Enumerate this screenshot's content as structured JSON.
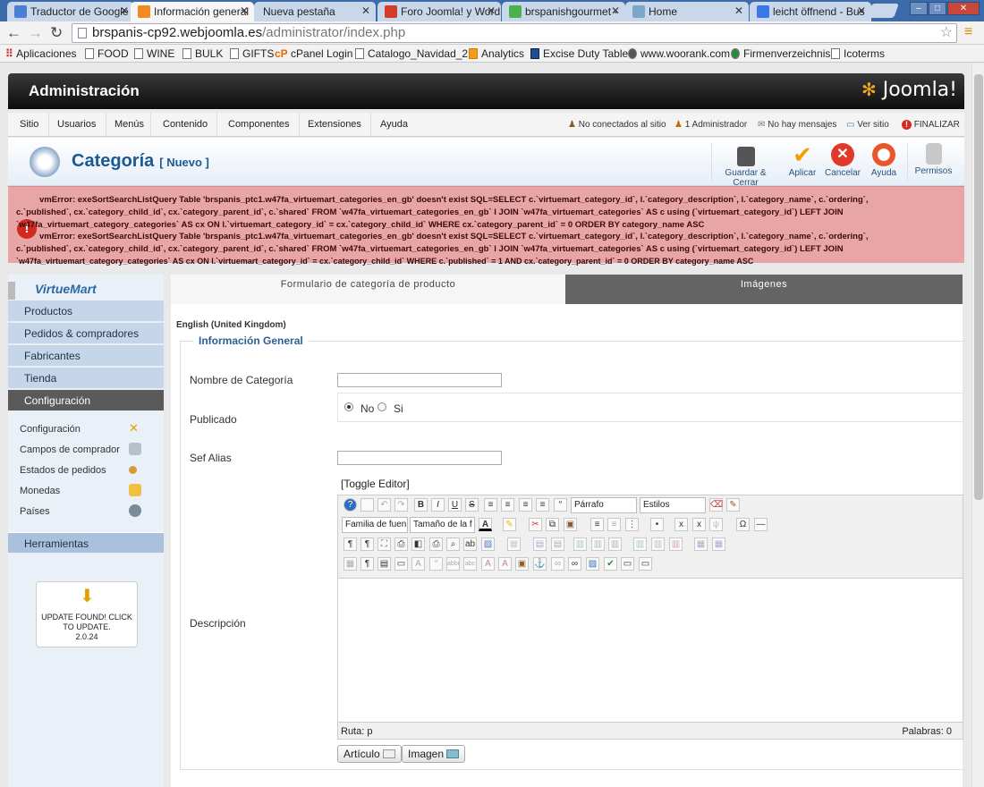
{
  "browser": {
    "tabs": [
      {
        "title": "Traductor de Google",
        "color": "#4a7fd4"
      },
      {
        "title": "Información general",
        "color": "#f08a24"
      },
      {
        "title": "Nueva pestaña",
        "color": "#dddddd"
      },
      {
        "title": "Foro Joomla! y Word",
        "color": "#d43c2a"
      },
      {
        "title": "brspanishgourmet -",
        "color": "#4caf50"
      },
      {
        "title": "Home",
        "color": "#7aa7c7"
      },
      {
        "title": "leicht öffnend - Bus",
        "color": "#3b78e7"
      }
    ],
    "window_buttons": [
      "–",
      "□",
      "✕"
    ],
    "url_host": "brspanis-cp92.webjoomla.es",
    "url_path": "/administrator/index.php",
    "bookmarks": [
      "Aplicaciones",
      "FOOD",
      "WINE",
      "BULK",
      "GIFTS",
      "cPanel Login",
      "Catalogo_Navidad_2...",
      "Analytics",
      "Excise Duty Table",
      "www.woorank.com",
      "Firmenverzeichnis",
      "Icoterms"
    ],
    "bookmark_cp_prefix": "cP"
  },
  "admin": {
    "title": "Administración",
    "logo": "Joomla!",
    "menu": [
      "Sitio",
      "Usuarios",
      "Menús",
      "Contenido",
      "Componentes",
      "Extensiones",
      "Ayuda"
    ],
    "status": {
      "not_connected": "No conectados al sitio",
      "admins": "1 Administrador",
      "messages": "No hay mensajes",
      "view_site": "Ver sitio",
      "logout": "FINALIZAR"
    }
  },
  "page": {
    "title": "Categoría",
    "subtitle": "[ Nuevo ]",
    "toolbar": [
      "Guardar & Cerrar",
      "Aplicar",
      "Cancelar",
      "Ayuda",
      "Permisos"
    ]
  },
  "errors": [
    "vmError: exeSortSearchListQuery Table 'brspanis_ptc1.w47fa_virtuemart_categories_en_gb' doesn't exist SQL=SELECT c.`virtuemart_category_id`, l.`category_description`, l.`category_name`, c.`ordering`,",
    "c.`published`, cx.`category_child_id`, cx.`category_parent_id`, c.`shared` FROM `w47fa_virtuemart_categories_en_gb` l JOIN `w47fa_virtuemart_categories` AS c using (`virtuemart_category_id`) LEFT JOIN",
    "`w47fa_virtuemart_category_categories` AS cx ON l.`virtuemart_category_id` = cx.`category_child_id` WHERE cx.`category_parent_id` = 0 ORDER BY category_name ASC",
    "vmError: exeSortSearchListQuery Table 'brspanis_ptc1.w47fa_virtuemart_categories_en_gb' doesn't exist SQL=SELECT c.`virtuemart_category_id`, l.`category_description`, l.`category_name`, c.`ordering`,",
    "c.`published`, cx.`category_child_id`, cx.`category_parent_id`, c.`shared` FROM `w47fa_virtuemart_categories_en_gb` l JOIN `w47fa_virtuemart_categories` AS c using (`virtuemart_category_id`) LEFT JOIN",
    "`w47fa_virtuemart_category_categories` AS cx ON l.`virtuemart_category_id` = cx.`category_child_id` WHERE c.`published` = 1 AND cx.`category_parent_id` = 0 ORDER BY category_name ASC"
  ],
  "sidebar": {
    "logo": "VirtueMart",
    "main": [
      "Productos",
      "Pedidos & compradores",
      "Fabricantes",
      "Tienda",
      "Configuración"
    ],
    "sub": [
      "Configuración",
      "Campos de comprador",
      "Estados de pedidos",
      "Monedas",
      "Países"
    ],
    "tools": "Herramientas",
    "update_lines": [
      "UPDATE FOUND! CLICK",
      "TO UPDATE.",
      "2.0.24"
    ]
  },
  "form": {
    "tab_active": "Formulario de categoría de producto",
    "tab_images": "Imágenes",
    "language": "English (United Kingdom)",
    "legend": "Información General",
    "name_label": "Nombre de Categoría",
    "name_value": "",
    "published_label": "Publicado",
    "published_no": "No",
    "published_yes": "Si",
    "published_value": "No",
    "alias_label": "Sef Alias",
    "alias_value": "",
    "toggle_editor": "[Toggle Editor]",
    "description_label": "Descripción",
    "editor": {
      "format": "Párrafo",
      "styles": "Estilos",
      "font_family": "Familia de fuen",
      "font_size": "Tamaño de la f",
      "path_label": "Ruta:",
      "path_value": "p",
      "words": "Palabras: 0"
    },
    "buttons": {
      "article": "Artículo",
      "image": "Imagen"
    }
  }
}
